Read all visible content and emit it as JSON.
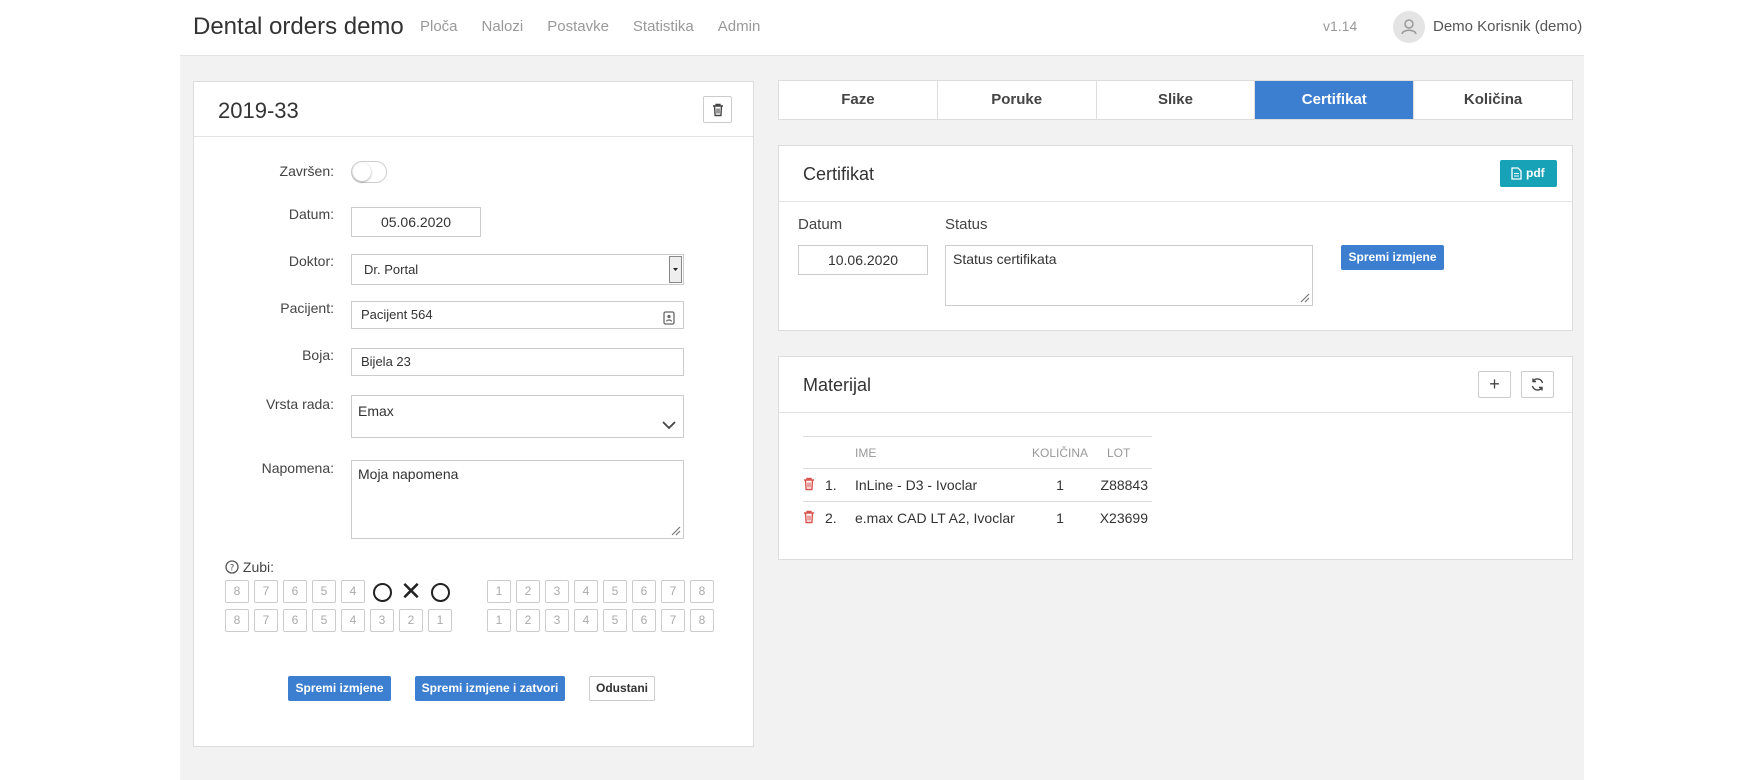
{
  "app": {
    "title": "Dental orders demo",
    "nav": [
      "Ploča",
      "Nalozi",
      "Postavke",
      "Statistika",
      "Admin"
    ],
    "version": "v1.14",
    "user": "Demo Korisnik (demo)"
  },
  "order": {
    "number": "2019-33",
    "fields": {
      "zavrsen_label": "Završen:",
      "zavrsen_value": false,
      "datum_label": "Datum:",
      "datum_value": "05.06.2020",
      "doktor_label": "Doktor:",
      "doktor_value": "Dr. Portal",
      "pacijent_label": "Pacijent:",
      "pacijent_value": "Pacijent 564",
      "boja_label": "Boja:",
      "boja_value": "Bijela 23",
      "vrsta_label": "Vrsta rada:",
      "vrsta_value": "Emax",
      "napomena_label": "Napomena:",
      "napomena_value": "Moja napomena"
    },
    "teeth": {
      "label": "Zubi:",
      "upper_left": [
        "8",
        "7",
        "6",
        "5",
        "4",
        "",
        "",
        ""
      ],
      "upper_left_marks": [
        "",
        "",
        "",
        "",
        "",
        "circle",
        "cross",
        "circle"
      ],
      "upper_right": [
        "1",
        "2",
        "3",
        "4",
        "5",
        "6",
        "7",
        "8"
      ],
      "lower_left": [
        "8",
        "7",
        "6",
        "5",
        "4",
        "3",
        "2",
        "1"
      ],
      "lower_right": [
        "1",
        "2",
        "3",
        "4",
        "5",
        "6",
        "7",
        "8"
      ]
    },
    "buttons": {
      "save": "Spremi izmjene",
      "save_close": "Spremi izmjene i zatvori",
      "cancel": "Odustani"
    }
  },
  "tabs": [
    {
      "label": "Faze",
      "active": false
    },
    {
      "label": "Poruke",
      "active": false
    },
    {
      "label": "Slike",
      "active": false
    },
    {
      "label": "Certifikat",
      "active": true
    },
    {
      "label": "Količina",
      "active": false
    }
  ],
  "certificate": {
    "title": "Certifikat",
    "pdf_label": "pdf",
    "datum_label": "Datum",
    "datum_value": "10.06.2020",
    "status_label": "Status",
    "status_value": "Status certifikata",
    "save_label": "Spremi izmjene"
  },
  "material": {
    "title": "Materijal",
    "columns": [
      "IME",
      "KOLIČINA",
      "LOT"
    ],
    "rows": [
      {
        "index": "1.",
        "name": "InLine - D3 - Ivoclar",
        "qty": "1",
        "lot": "Z88843"
      },
      {
        "index": "2.",
        "name": "e.max CAD LT A2, Ivoclar",
        "qty": "1",
        "lot": "X23699"
      }
    ]
  },
  "colors": {
    "primary": "#3c7fd0",
    "info": "#17a2b8",
    "danger": "#d9534f",
    "background": "#f2f2f2"
  }
}
